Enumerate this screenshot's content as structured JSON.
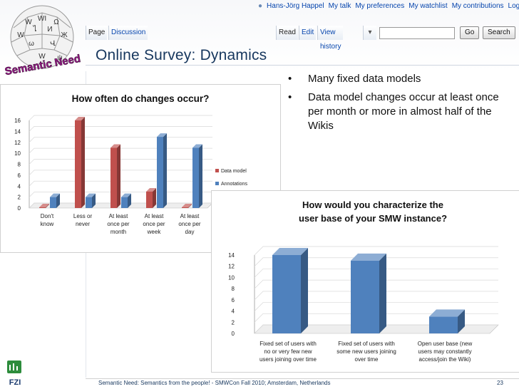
{
  "logo": {
    "text": "Semantic Need",
    "globe_letters": [
      "W",
      "WI",
      "Ω",
      "W",
      "ไ",
      "И",
      "Ж",
      "ω",
      "Վ",
      "W",
      "ψ"
    ]
  },
  "user_bar": {
    "user": "Hans-Jörg Happel",
    "links": [
      "My talk",
      "My preferences",
      "My watchlist",
      "My contributions",
      "Log out"
    ]
  },
  "tabs": {
    "page": "Page",
    "discussion": "Discussion",
    "read": "Read",
    "edit": "Edit",
    "history": "View history",
    "more": "▾"
  },
  "search": {
    "go": "Go",
    "search": "Search"
  },
  "slide": {
    "title": "Online Survey: Dynamics",
    "bullets": [
      "Many fixed data models",
      "Data model changes occur at least once per month or more in almost half of the Wikis"
    ],
    "footer": "Semantic Need: Semantics from the people! - SMWCon Fall 2010; Amsterdam, Netherlands",
    "page_number": "23",
    "brand": "FZI"
  },
  "colors": {
    "red": "#c0504d",
    "blue": "#4f81bd",
    "title": "#17375e"
  },
  "chart_data": [
    {
      "type": "bar",
      "title": "How often do changes occur?",
      "categories": [
        [
          "Don't",
          "know"
        ],
        [
          "Less or",
          "never"
        ],
        [
          "At least",
          "once per",
          "month"
        ],
        [
          "At least",
          "once per",
          "week"
        ],
        [
          "At least",
          "once per",
          "day"
        ]
      ],
      "series": [
        {
          "name": "Data model",
          "values": [
            0,
            16,
            11,
            3,
            0
          ]
        },
        {
          "name": "Annotations",
          "values": [
            2,
            2,
            2,
            13,
            11
          ]
        }
      ],
      "yticks": [
        "0",
        "2",
        "4",
        "6",
        "8",
        "10",
        "12",
        "14",
        "16"
      ],
      "ylim": [
        0,
        16
      ],
      "legend": "right",
      "grid": true
    },
    {
      "type": "bar",
      "title": [
        "How would you characterize the",
        "user base of your SMW instance?"
      ],
      "categories": [
        [
          "Fixed set of users with",
          "no or very few new",
          "users joining over time"
        ],
        [
          "Fixed set of users with",
          "some new users joining",
          "over time"
        ],
        [
          "Open user base (new",
          "users may constantly",
          "access/join the Wiki)"
        ]
      ],
      "values": [
        14,
        13,
        3
      ],
      "yticks": [
        "0",
        "2",
        "4",
        "6",
        "8",
        "10",
        "12",
        "14"
      ],
      "ylim": [
        0,
        14
      ],
      "grid": true
    }
  ]
}
